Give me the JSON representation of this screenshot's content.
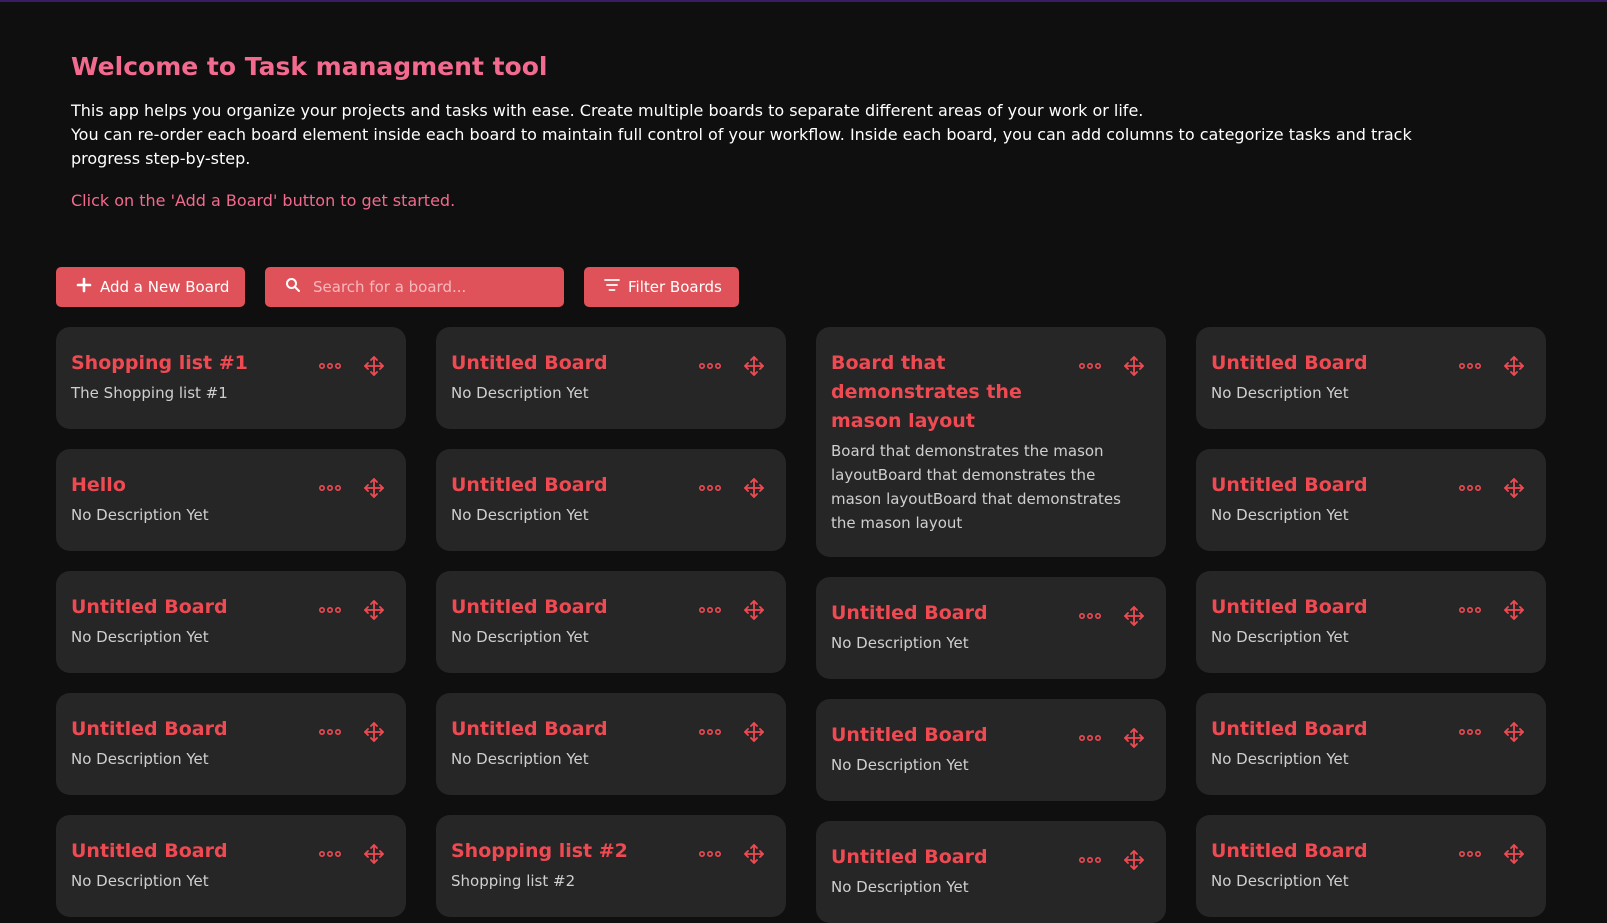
{
  "hero": {
    "title": "Welcome to Task managment tool",
    "desc_line1": "This app helps you organize your projects and tasks with ease. Create multiple boards to separate different areas of your work or life.",
    "desc_line2": "You can re-order each board element inside each board to maintain full control of your workflow. Inside each board, you can add columns to categorize tasks and track progress step-by-step.",
    "cta": "Click on the 'Add a Board' button to get started."
  },
  "toolbar": {
    "add_label": "Add a New Board",
    "search_placeholder": "Search for a board...",
    "filter_label": "Filter Boards"
  },
  "colors": {
    "accent": "#e05259",
    "title": "#ef4a52",
    "heading": "#f26a8d",
    "card_bg": "#262627",
    "page_bg": "#0f0f10"
  },
  "icons": {
    "add": "plus-icon",
    "search": "search-icon",
    "filter": "filter-icon",
    "more": "more-horizontal-icon",
    "drag": "move-icon"
  },
  "columns": [
    {
      "boards": [
        {
          "title": "Shopping list #1",
          "desc": "The Shopping list #1"
        },
        {
          "title": "Hello",
          "desc": "No Description Yet"
        },
        {
          "title": "Untitled Board",
          "desc": "No Description Yet"
        },
        {
          "title": "Untitled Board",
          "desc": "No Description Yet"
        },
        {
          "title": "Untitled Board",
          "desc": "No Description Yet"
        }
      ]
    },
    {
      "boards": [
        {
          "title": "Untitled Board",
          "desc": "No Description Yet"
        },
        {
          "title": "Untitled Board",
          "desc": "No Description Yet"
        },
        {
          "title": "Untitled Board",
          "desc": "No Description Yet"
        },
        {
          "title": "Untitled Board",
          "desc": "No Description Yet"
        },
        {
          "title": "Shopping list #2",
          "desc": "Shopping list #2"
        }
      ]
    },
    {
      "boards": [
        {
          "title": "Board that demonstrates the mason layout",
          "desc": "Board that demonstrates the mason layoutBoard that demonstrates the mason layoutBoard that demonstrates the mason layout"
        },
        {
          "title": "Untitled Board",
          "desc": "No Description Yet"
        },
        {
          "title": "Untitled Board",
          "desc": "No Description Yet"
        },
        {
          "title": "Untitled Board",
          "desc": "No Description Yet"
        }
      ]
    },
    {
      "boards": [
        {
          "title": "Untitled Board",
          "desc": "No Description Yet"
        },
        {
          "title": "Untitled Board",
          "desc": "No Description Yet"
        },
        {
          "title": "Untitled Board",
          "desc": "No Description Yet"
        },
        {
          "title": "Untitled Board",
          "desc": "No Description Yet"
        },
        {
          "title": "Untitled Board",
          "desc": "No Description Yet"
        }
      ]
    }
  ]
}
